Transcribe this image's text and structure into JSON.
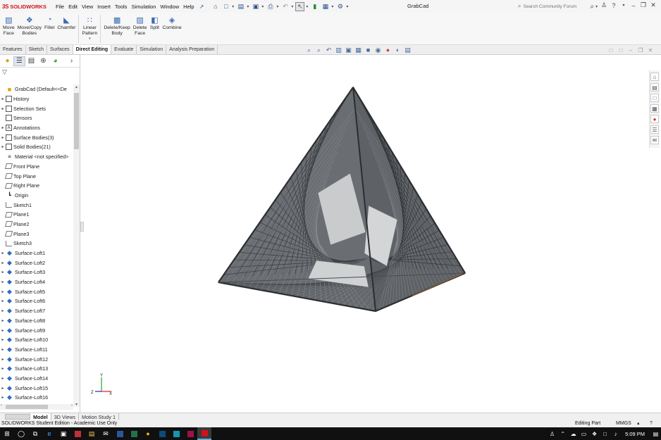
{
  "app": {
    "logo_prefix": "3S",
    "logo_name": "SOLIDWORKS",
    "document_title": "GrabCad"
  },
  "menu": [
    "File",
    "Edit",
    "View",
    "Insert",
    "Tools",
    "Simulation",
    "Window",
    "Help"
  ],
  "search": {
    "placeholder": "Search Community Forum"
  },
  "help_label": "?",
  "commands": [
    {
      "label": "Move\nFace",
      "icon": "move-face-icon"
    },
    {
      "label": "Move/Copy\nBodies",
      "icon": "move-copy-bodies-icon"
    },
    {
      "label": "Fillet",
      "icon": "fillet-icon"
    },
    {
      "label": "Chamfer",
      "icon": "chamfer-icon"
    },
    {
      "label": "Linear\nPattern",
      "icon": "linear-pattern-icon"
    },
    {
      "label": "Delete/Keep\nBody",
      "icon": "delete-keep-body-icon"
    },
    {
      "label": "Delete\nFace",
      "icon": "delete-face-icon"
    },
    {
      "label": "Split",
      "icon": "split-icon"
    },
    {
      "label": "Combine",
      "icon": "combine-icon"
    }
  ],
  "tabs": [
    "Features",
    "Sketch",
    "Surfaces",
    "Direct Editing",
    "Evaluate",
    "Simulation",
    "Analysis Preparation"
  ],
  "active_tab": "Direct Editing",
  "tree": {
    "root": "GrabCad  (Default<<De",
    "items": [
      {
        "label": "History",
        "type": "folder",
        "expandable": true
      },
      {
        "label": "Selection Sets",
        "type": "folder",
        "expandable": true
      },
      {
        "label": "Sensors",
        "type": "folder",
        "expandable": false
      },
      {
        "label": "Annotations",
        "type": "annot",
        "expandable": true
      },
      {
        "label": "Surface Bodies(3)",
        "type": "folder",
        "expandable": true
      },
      {
        "label": "Solid Bodies(21)",
        "type": "folder",
        "expandable": true
      },
      {
        "label": "Material <not specified>",
        "type": "material",
        "expandable": false
      },
      {
        "label": "Front Plane",
        "type": "plane",
        "expandable": false
      },
      {
        "label": "Top Plane",
        "type": "plane",
        "expandable": false
      },
      {
        "label": "Right Plane",
        "type": "plane",
        "expandable": false
      },
      {
        "label": "Origin",
        "type": "origin",
        "expandable": false
      },
      {
        "label": "Sketch1",
        "type": "sketch",
        "expandable": false
      },
      {
        "label": "Plane1",
        "type": "plane",
        "expandable": false
      },
      {
        "label": "Plane2",
        "type": "plane",
        "expandable": false
      },
      {
        "label": "Plane3",
        "type": "plane",
        "expandable": false
      },
      {
        "label": "Sketch3",
        "type": "sketch",
        "expandable": false
      },
      {
        "label": "Surface-Loft1",
        "type": "loft",
        "expandable": true
      },
      {
        "label": "Surface-Loft2",
        "type": "loft",
        "expandable": true
      },
      {
        "label": "Surface-Loft3",
        "type": "loft",
        "expandable": true
      },
      {
        "label": "Surface-Loft4",
        "type": "loft",
        "expandable": true
      },
      {
        "label": "Surface-Loft5",
        "type": "loft",
        "expandable": true
      },
      {
        "label": "Surface-Loft6",
        "type": "loft",
        "expandable": true
      },
      {
        "label": "Surface-Loft7",
        "type": "loft",
        "expandable": true
      },
      {
        "label": "Surface-Loft8",
        "type": "loft",
        "expandable": true
      },
      {
        "label": "Surface-Loft9",
        "type": "loft",
        "expandable": true
      },
      {
        "label": "Surface-Loft10",
        "type": "loft",
        "expandable": true
      },
      {
        "label": "Surface-Loft11",
        "type": "loft",
        "expandable": true
      },
      {
        "label": "Surface-Loft12",
        "type": "loft",
        "expandable": true
      },
      {
        "label": "Surface-Loft13",
        "type": "loft",
        "expandable": true
      },
      {
        "label": "Surface-Loft14",
        "type": "loft",
        "expandable": true
      },
      {
        "label": "Surface-Loft15",
        "type": "loft",
        "expandable": true
      },
      {
        "label": "Surface-Loft16",
        "type": "loft",
        "expandable": true
      }
    ]
  },
  "triad": {
    "x": "X",
    "y": "Y",
    "z": "Z"
  },
  "bottom_tabs": [
    "Model",
    "3D Views",
    "Motion Study 1"
  ],
  "active_bottom_tab": "Model",
  "status": {
    "left": "SOLIDWORKS Student Edition - Academic Use Only",
    "mode": "Editing Part",
    "units": "MMGS"
  },
  "taskbar": {
    "time": "5:09 PM"
  },
  "colors": {
    "model_fill": "#6a6e72",
    "model_edge": "#2b2e31",
    "brand_red": "#d0121b",
    "accent_blue": "#2d6cc0"
  }
}
